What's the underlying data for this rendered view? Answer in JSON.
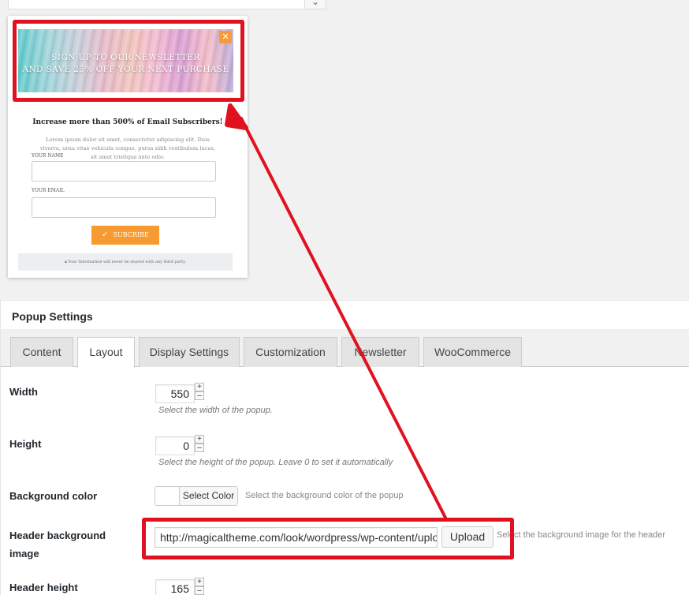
{
  "preview": {
    "hero_line1": "SIGN UP TO OUR NEWSLETTER",
    "hero_line2": "AND SAVE 25% OFF YOUR NEXT PURCHASE",
    "title": "Increase more than 500% of Email Subscribers!",
    "lorem": "Lorem ipsum dolor sit amet, consectetur adipiscing elit. Duis viverra, urna vitae vehicula congue, purus nibh vestibulum lacus, sit amet tristique ante odio.",
    "name_label": "YOUR NAME",
    "email_label": "YOUR EMAIL",
    "subscribe_label": "SUBCRIBE",
    "privacy_note": "Your Information will never be shared with any third party."
  },
  "panel": {
    "title": "Popup Settings",
    "tabs": [
      {
        "label": "Content"
      },
      {
        "label": "Layout"
      },
      {
        "label": "Display Settings"
      },
      {
        "label": "Customization"
      },
      {
        "label": "Newsletter"
      },
      {
        "label": "WooCommerce"
      }
    ],
    "active_tab": "Layout"
  },
  "fields": {
    "width": {
      "label": "Width",
      "value": "550",
      "hint": "Select the width of the popup."
    },
    "height": {
      "label": "Height",
      "value": "0",
      "hint": "Select the height of the popup. Leave 0 to set it automatically"
    },
    "bg_color": {
      "label": "Background color",
      "button": "Select Color",
      "hint": "Select the background color of the popup"
    },
    "header_bg": {
      "label_line1": "Header background",
      "label_line2": "image",
      "value": "http://magicaltheme.com/look/wordpress/wp-content/uploads",
      "button": "Upload",
      "hint": "Select the background image for the header"
    },
    "header_height": {
      "label": "Header height",
      "value": "165"
    }
  },
  "colors": {
    "highlight": "#e0121f",
    "accent_orange": "#f79a2f"
  }
}
